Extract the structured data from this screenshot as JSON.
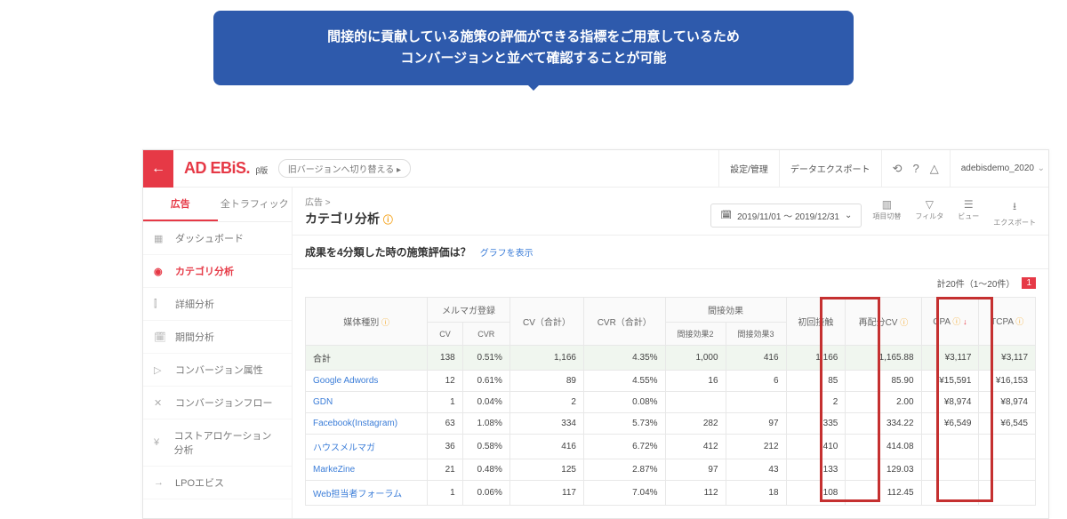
{
  "callout": {
    "line1": "間接的に貢献している施策の評価ができる指標をご用意しているため",
    "line2": "コンバージョンと並べて確認することが可能"
  },
  "topbar": {
    "logo": "AD EBiS.",
    "beta": "β版",
    "switch": "旧バージョンへ切り替える ▸",
    "settings": "設定/管理",
    "export": "データエクスポート",
    "account": "adebisdemo_2020"
  },
  "tabs": {
    "ad": "広告",
    "all": "全トラフィック"
  },
  "sidebar": [
    {
      "icon": "▦",
      "label": "ダッシュボード"
    },
    {
      "icon": "◉",
      "label": "カテゴリ分析",
      "active": true
    },
    {
      "icon": "⫿",
      "label": "詳細分析"
    },
    {
      "icon": "🗓",
      "label": "期間分析"
    },
    {
      "icon": "▷",
      "label": "コンバージョン属性"
    },
    {
      "icon": "✕",
      "label": "コンバージョンフロー"
    },
    {
      "icon": "¥",
      "label": "コストアロケーション分析"
    },
    {
      "icon": "→",
      "label": "LPOエビス"
    }
  ],
  "page": {
    "breadcrumb": "広告 >",
    "title": "カテゴリ分析",
    "date_range": "2019/11/01 ～ 2019/12/31",
    "subheader": "成果を4分類した時の施策評価は？",
    "graph_link": "グラフを表示",
    "count": "計20件（1～20件）",
    "page_num": "1"
  },
  "toolbar": {
    "columns": "項目切替",
    "filter": "フィルタ",
    "view": "ビュー",
    "export": "エクスポート"
  },
  "headers": {
    "media": "媒体種別",
    "mailmag": "メルマガ登録",
    "cv": "CV",
    "cvr": "CVR",
    "cv_total": "CV（合計）",
    "cvr_total": "CVR（合計）",
    "indirect": "間接効果",
    "indirect2": "間接効果2",
    "indirect3": "間接効果3",
    "first_touch": "初回接触",
    "redist_cv": "再配分CV",
    "cpa": "CPA",
    "tcpa": "TCPA"
  },
  "rows": [
    {
      "label": "合計",
      "total": true,
      "cv": "138",
      "cvr": "0.51%",
      "cv_total": "1,166",
      "cvr_total": "4.35%",
      "ind2": "1,000",
      "ind3": "416",
      "first": "1,166",
      "redist": "1,165.88",
      "cpa": "¥3,117",
      "tcpa": "¥3,117"
    },
    {
      "label": "Google Adwords",
      "link": true,
      "cv": "12",
      "cvr": "0.61%",
      "cv_total": "89",
      "cvr_total": "4.55%",
      "ind2": "16",
      "ind3": "6",
      "first": "85",
      "redist": "85.90",
      "cpa": "¥15,591",
      "tcpa": "¥16,153"
    },
    {
      "label": "GDN",
      "link": true,
      "cv": "1",
      "cvr": "0.04%",
      "cv_total": "2",
      "cvr_total": "0.08%",
      "ind2": "",
      "ind3": "",
      "first": "2",
      "redist": "2.00",
      "cpa": "¥8,974",
      "tcpa": "¥8,974"
    },
    {
      "label": "Facebook(Instagram)",
      "link": true,
      "cv": "63",
      "cvr": "1.08%",
      "cv_total": "334",
      "cvr_total": "5.73%",
      "ind2": "282",
      "ind3": "97",
      "first": "335",
      "redist": "334.22",
      "cpa": "¥6,549",
      "tcpa": "¥6,545"
    },
    {
      "label": "ハウスメルマガ",
      "link": true,
      "cv": "36",
      "cvr": "0.58%",
      "cv_total": "416",
      "cvr_total": "6.72%",
      "ind2": "412",
      "ind3": "212",
      "first": "410",
      "redist": "414.08",
      "cpa": "",
      "tcpa": ""
    },
    {
      "label": "MarkeZine",
      "link": true,
      "cv": "21",
      "cvr": "0.48%",
      "cv_total": "125",
      "cvr_total": "2.87%",
      "ind2": "97",
      "ind3": "43",
      "first": "133",
      "redist": "129.03",
      "cpa": "",
      "tcpa": ""
    },
    {
      "label": "Web担当者フォーラム",
      "link": true,
      "cv": "1",
      "cvr": "0.06%",
      "cv_total": "117",
      "cvr_total": "7.04%",
      "ind2": "112",
      "ind3": "18",
      "first": "108",
      "redist": "112.45",
      "cpa": "",
      "tcpa": ""
    }
  ]
}
